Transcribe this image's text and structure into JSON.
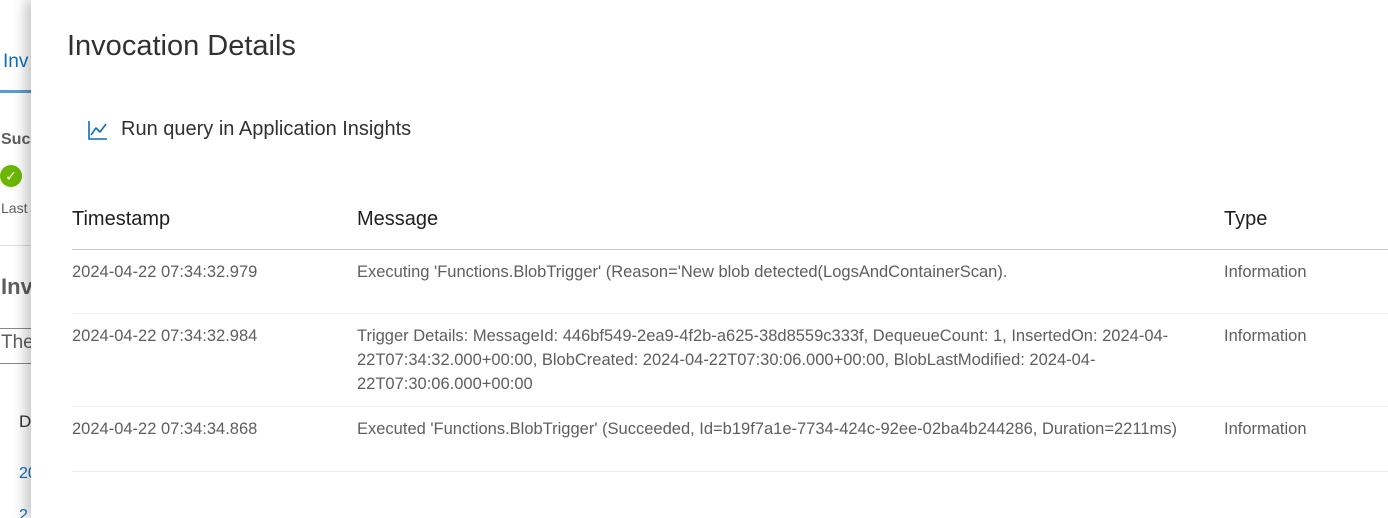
{
  "background_page": {
    "tab_label": "Inv",
    "success_label": "Suc",
    "last_label": "Last",
    "section_heading": "Inv",
    "filter_text": "The",
    "column_partial": "D",
    "row_links": [
      "20",
      "2"
    ]
  },
  "panel": {
    "title": "Invocation Details",
    "action": {
      "icon": "line-chart-icon",
      "label": "Run query in Application Insights"
    },
    "table": {
      "columns": [
        "Timestamp",
        "Message",
        "Type"
      ],
      "rows": [
        {
          "timestamp": "2024-04-22 07:34:32.979",
          "message": "Executing 'Functions.BlobTrigger' (Reason='New blob detected(LogsAndContainerScan).",
          "type": "Information"
        },
        {
          "timestamp": "2024-04-22 07:34:32.984",
          "message": "Trigger Details: MessageId: 446bf549-2ea9-4f2b-a625-38d8559c333f, DequeueCount: 1, InsertedOn: 2024-04-22T07:34:32.000+00:00, BlobCreated: 2024-04-22T07:30:06.000+00:00, BlobLastModified: 2024-04-22T07:30:06.000+00:00",
          "type": "Information"
        },
        {
          "timestamp": "2024-04-22 07:34:34.868",
          "message": "Executed 'Functions.BlobTrigger' (Succeeded, Id=b19f7a1e-7734-424c-92ee-02ba4b244286, Duration=2211ms)",
          "type": "Information"
        }
      ]
    }
  },
  "colors": {
    "accent": "#0f6cbd",
    "success": "#6bb700",
    "text_primary": "#323130",
    "text_secondary": "#605e5c"
  }
}
